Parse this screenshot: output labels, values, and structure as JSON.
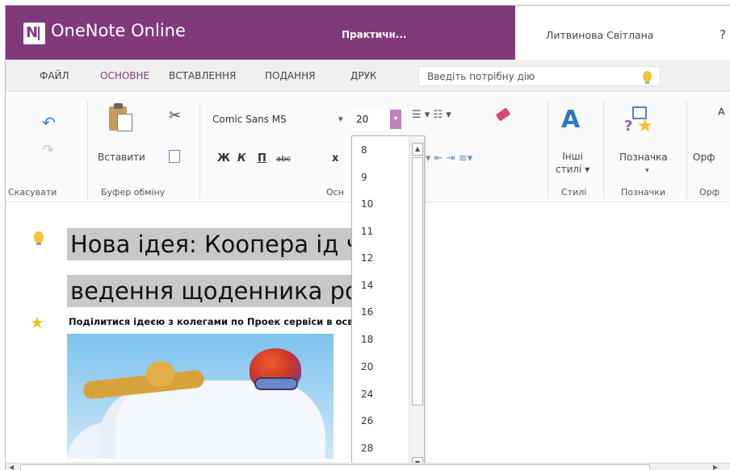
{
  "titlebar": {
    "app_name": "OneNote Online",
    "document_name": "Практичн...",
    "user_name": "Литвинова Світлана",
    "help_label": "?",
    "brand_color": "#80397b"
  },
  "tabs": [
    {
      "label": "ФАЙЛ",
      "active": false
    },
    {
      "label": "ОСНОВНЕ",
      "active": true
    },
    {
      "label": "ВСТАВЛЕННЯ",
      "active": false
    },
    {
      "label": "ПОДАННЯ",
      "active": false
    },
    {
      "label": "ДРУК",
      "active": false
    }
  ],
  "tell_me": {
    "placeholder": "Введіть потрібну дію"
  },
  "ribbon": {
    "undo_group": {
      "label": "Скасувати",
      "undo_icon": "undo-icon",
      "redo_icon": "redo-icon"
    },
    "clipboard_group": {
      "label": "Буфер обміну",
      "paste_label": "Вставити",
      "cut_icon": "scissors-icon",
      "format_painter_icon": "copy-format-icon"
    },
    "font_group": {
      "label": "Осн",
      "font_name": "Comic Sans MS",
      "font_size": "20",
      "bold": "Ж",
      "italic": "К",
      "underline": "П",
      "strike": "abc",
      "subscript": "x"
    },
    "styles_group": {
      "label": "Стилі",
      "button_line1": "Інші",
      "button_line2": "стилі ▾"
    },
    "tags_group": {
      "label": "Позначки",
      "button_label": "Позначка"
    },
    "spelling_group": {
      "label": "Орф",
      "button_label": "Орф"
    }
  },
  "font_size_dropdown": {
    "options": [
      "8",
      "9",
      "10",
      "11",
      "12",
      "14",
      "16",
      "18",
      "20",
      "24",
      "26",
      "28"
    ]
  },
  "page": {
    "title_line1": "Нова ідея: Коопера            ід час",
    "title_line2": "ведення щоденника           роди",
    "subtitle": "Поділитися ідеєю з колегами по Проек                    сервіси в освіті\""
  }
}
